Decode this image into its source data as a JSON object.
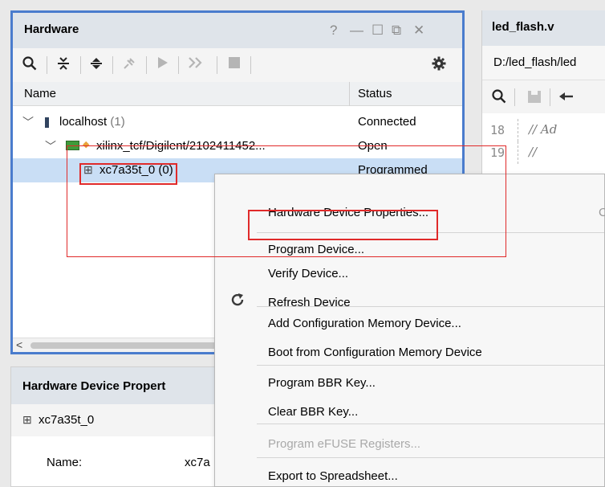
{
  "hardware_panel": {
    "title": "Hardware",
    "window_controls": [
      "?",
      "—",
      "☐",
      "⧉",
      "✕"
    ],
    "toolbar": {
      "search_icon": "search-icon",
      "collapse_all_icon": "collapse-all-icon",
      "expand_all_icon": "expand-all-icon",
      "connect_icon": "plug-icon",
      "run_icon": "run-icon",
      "forward_icon": "fast-forward-icon",
      "stop_icon": "stop-icon",
      "settings_icon": "gear-icon"
    },
    "columns": {
      "name": "Name",
      "status": "Status"
    },
    "rows": [
      {
        "label": "localhost",
        "count": "(1)",
        "status": "Connected"
      },
      {
        "label": "xilinx_tcf/Digilent/2102411452...",
        "status": "Open"
      },
      {
        "label": "xc7a35t",
        "label_suffix": "_0 (0)",
        "status": "Programmed"
      }
    ]
  },
  "editor_panel": {
    "title": "led_flash.v",
    "path": "D:/led_flash/led",
    "code_lines": [
      {
        "num": "18",
        "text": "// Ad"
      },
      {
        "num": "19",
        "text": "//"
      }
    ]
  },
  "device_properties": {
    "title": "Hardware Device Propert",
    "device": "xc7a35t_0",
    "name_key": "Name:",
    "name_value": "xc7a"
  },
  "context_menu": {
    "items": [
      {
        "label": "Hardware Device Properties...",
        "shortcut": "C",
        "enabled": true
      },
      {
        "label": "Program Device...",
        "enabled": true
      },
      {
        "label": "Verify Device...",
        "enabled": true
      },
      {
        "label": "Refresh Device",
        "icon": "refresh-icon",
        "enabled": true
      },
      {
        "label": "Add Configuration Memory Device...",
        "enabled": true
      },
      {
        "label": "Boot from Configuration Memory Device",
        "enabled": true
      },
      {
        "label": "Program BBR Key...",
        "enabled": true
      },
      {
        "label": "Clear BBR Key...",
        "enabled": true
      },
      {
        "label": "Program eFUSE Registers...",
        "enabled": false
      },
      {
        "label": "Export to Spreadsheet...",
        "enabled": true
      }
    ]
  },
  "colors": {
    "highlight": "#e02a2a",
    "panel_border_active": "#4a7ccd",
    "selected_row": "#c9def5"
  }
}
